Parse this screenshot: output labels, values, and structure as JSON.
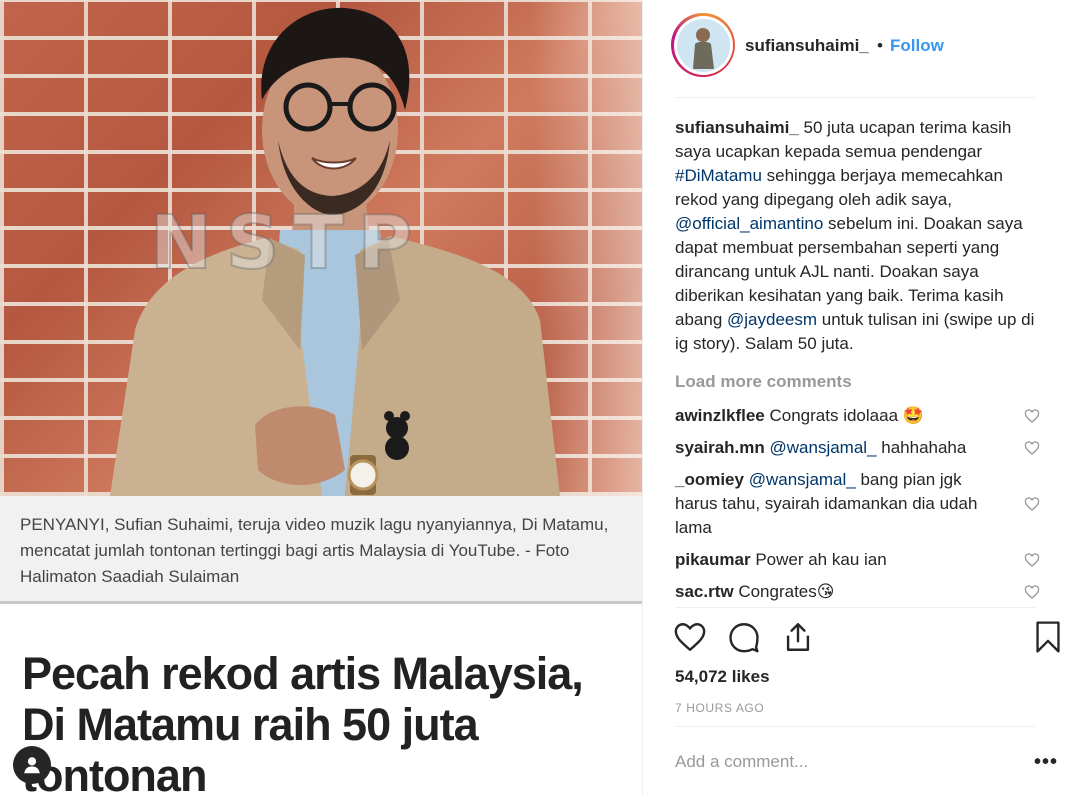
{
  "post_image": {
    "watermark": "NSTP",
    "photo_caption": "PENYANYI, Sufian Suhaimi, teruja video muzik lagu nyanyiannya, Di Matamu, mencatat jumlah tontonan tertinggi bagi artis Malaysia di YouTube. - Foto Halimaton Saadiah Sulaiman",
    "headline": "Pecah rekod artis Malaysia, Di Matamu raih 50 juta tontonan"
  },
  "header": {
    "username": "sufiansuhaimi_",
    "separator": "•",
    "follow_label": "Follow"
  },
  "caption": {
    "username": "sufiansuhaimi_",
    "text_1": " 50 juta ucapan terima kasih saya ucapkan kepada semua pendengar ",
    "hashtag": "#DiMatamu",
    "text_2": " sehingga berjaya memecahkan rekod yang dipegang oleh adik saya, ",
    "mention_1": "@official_aimantino",
    "text_3": " sebelum ini. Doakan saya dapat membuat persembahan seperti yang dirancang untuk AJL nanti. Doakan saya diberikan kesihatan yang baik. Terima kasih abang ",
    "mention_2": "@jaydeesm",
    "text_4": " untuk tulisan ini (swipe up di ig story). Salam 50 juta."
  },
  "load_more_label": "Load more comments",
  "comments": [
    {
      "username": "awinzlkflee",
      "mention": "",
      "text": " Congrats idolaaa 🤩"
    },
    {
      "username": "syairah.mn",
      "mention": "@wansjamal_",
      "text": " hahhahaha"
    },
    {
      "username": "_oomiey",
      "mention": "@wansjamal_",
      "text": " bang pian jgk harus tahu, syairah idamankan dia udah lama"
    },
    {
      "username": "pikaumar",
      "mention": "",
      "text": " Power ah kau ian"
    },
    {
      "username": "sac.rtw",
      "mention": "",
      "text": " Congrates😘"
    }
  ],
  "likes_label": "54,072 likes",
  "time_ago": "7 HOURS AGO",
  "add_comment_placeholder": "Add a comment...",
  "more_options_label": "•••",
  "icons": [
    "heart-icon",
    "comment-icon",
    "share-icon",
    "bookmark-icon",
    "more-options-icon",
    "profile-icon"
  ],
  "colors": {
    "link_blue": "#3897f0",
    "mention_blue": "#003569",
    "muted": "#999999",
    "text": "#262626"
  }
}
